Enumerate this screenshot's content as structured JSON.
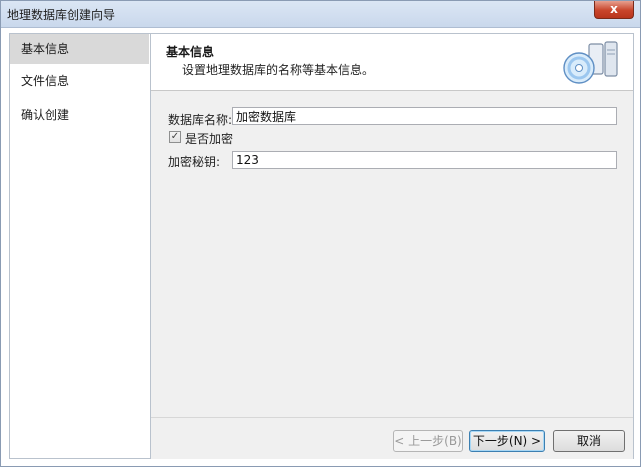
{
  "window": {
    "title": "地理数据库创建向导",
    "close_label": "x"
  },
  "sidebar": {
    "items": [
      {
        "label": "基本信息",
        "selected": true
      },
      {
        "label": "文件信息",
        "selected": false
      },
      {
        "label": "确认创建",
        "selected": false
      }
    ]
  },
  "header": {
    "title": "基本信息",
    "subtitle": "设置地理数据库的名称等基本信息。",
    "icon": "database-cd-icon"
  },
  "form": {
    "db_name_label": "数据库名称:",
    "db_name_value": "加密数据库",
    "encrypt_label": "是否加密",
    "encrypt_checked": true,
    "check_mark": "✓",
    "key_label": "加密秘钥:",
    "key_value": "123"
  },
  "buttons": {
    "prev": "< 上一步(B)",
    "next": "下一步(N) >",
    "cancel": "取消"
  },
  "colors": {
    "titlebar": "#c9d8ec",
    "close": "#c8452b",
    "selected_nav": "#d9d9d9",
    "panel": "#f0f0f0"
  }
}
